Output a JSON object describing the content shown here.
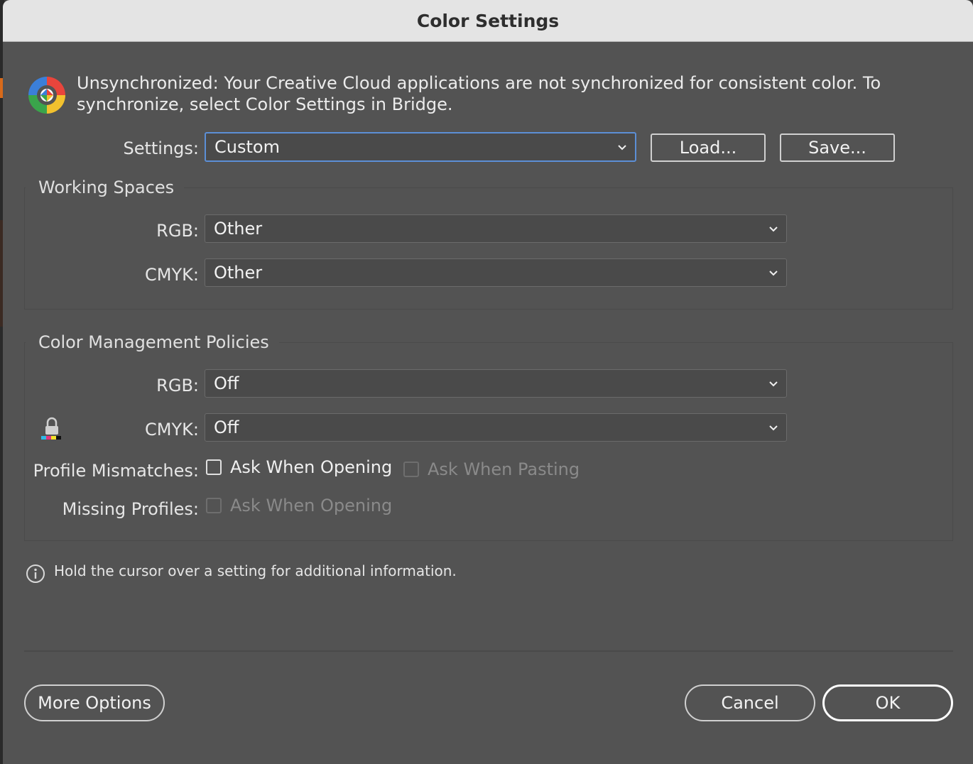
{
  "window": {
    "title": "Color Settings"
  },
  "sync": {
    "message": "Unsynchronized: Your Creative Cloud applications are not synchronized for consistent color. To synchronize, select Color Settings in Bridge.",
    "icon": "color-wheel-icon"
  },
  "settings": {
    "label": "Settings:",
    "value": "Custom",
    "load_label": "Load...",
    "save_label": "Save..."
  },
  "working_spaces": {
    "title": "Working Spaces",
    "rgb_label": "RGB:",
    "rgb_value": "Other",
    "cmyk_label": "CMYK:",
    "cmyk_value": "Other"
  },
  "policies": {
    "title": "Color Management Policies",
    "rgb_label": "RGB:",
    "rgb_value": "Off",
    "cmyk_label": "CMYK:",
    "cmyk_value": "Off",
    "lock_icon": "lock-icon",
    "profile_mismatches_label": "Profile Mismatches:",
    "mismatch_opening_label": "Ask When Opening",
    "mismatch_opening_checked": false,
    "mismatch_pasting_label": "Ask When Pasting",
    "mismatch_pasting_checked": false,
    "missing_profiles_label": "Missing Profiles:",
    "missing_opening_label": "Ask When Opening",
    "missing_opening_checked": false
  },
  "info": {
    "text": "Hold the cursor over a setting for additional information.",
    "icon": "info-icon"
  },
  "footer": {
    "more_options_label": "More Options",
    "cancel_label": "Cancel",
    "ok_label": "OK"
  },
  "colors": {
    "dialog_bg": "#535353",
    "titlebar_bg": "#e4e4e4",
    "focus_accent": "#5c8fd6"
  }
}
